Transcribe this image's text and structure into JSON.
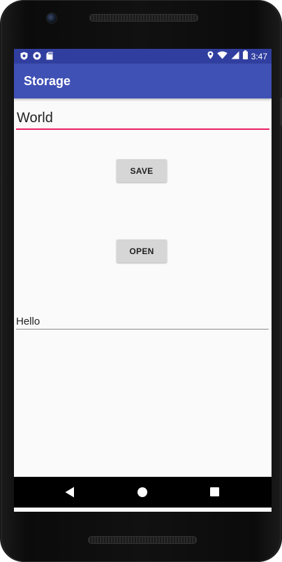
{
  "status_bar": {
    "time": "3:47",
    "left_icons": [
      "shield-icon",
      "circle-icon",
      "sd-card-icon"
    ],
    "right_icons": [
      "location-icon",
      "wifi-icon",
      "signal-icon",
      "battery-icon"
    ]
  },
  "app_bar": {
    "title": "Storage"
  },
  "main": {
    "top_input": {
      "value": "World",
      "placeholder": ""
    },
    "save_button": {
      "label": "SAVE"
    },
    "open_button": {
      "label": "OPEN"
    },
    "bottom_input": {
      "value": "Hello",
      "placeholder": ""
    }
  },
  "nav_bar": {
    "buttons": [
      "back-icon",
      "home-icon",
      "recents-icon"
    ]
  },
  "colors": {
    "status_bar": "#303f9f",
    "app_bar": "#3f51b5",
    "accent": "#e91e63",
    "button": "#d6d6d6",
    "background": "#fafafa"
  }
}
